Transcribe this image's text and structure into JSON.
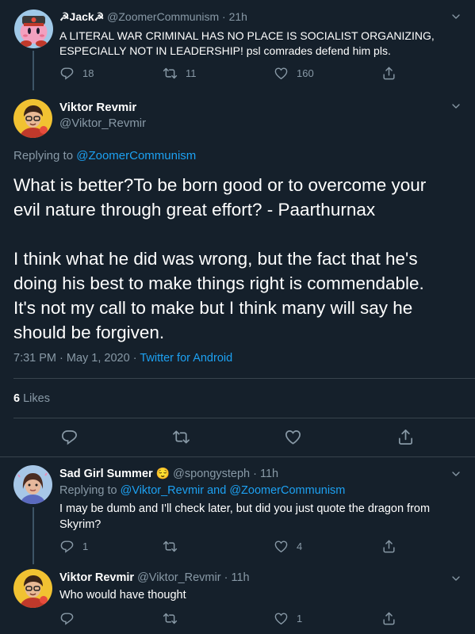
{
  "tweet1": {
    "name": "☭Jack☭",
    "handle": "@ZoomerCommunism",
    "time": "· 21h",
    "text_line1": "A LITERAL WAR CRIMINAL HAS NO PLACE IS SOCIALIST ORGANIZING,",
    "text_line2": "ESPECIALLY NOT IN LEADERSHIP! psl comrades defend him pls.",
    "replies": "18",
    "retweets": "11",
    "likes": "160"
  },
  "main_tweet": {
    "name": "Viktor Revmir",
    "handle": "@Viktor_Revmir",
    "replying_to_label": "Replying to",
    "replying_to_handle": "@ZoomerCommunism",
    "p1_l1": "What is better?To be born good or to overcome your",
    "p1_l2": "evil nature through great effort? - Paarthurnax",
    "p2_l1": "I think what he did was wrong, but the fact that he's",
    "p2_l2": "doing his best to make things right is commendable.",
    "p2_l3": "It's not my call to make but I think many will say he",
    "p2_l4": "should be forgiven.",
    "timestamp": "7:31 PM · May 1, 2020 · ",
    "client": "Twitter for Android",
    "likes_count": "6",
    "likes_label": "Likes"
  },
  "reply1": {
    "name": "Sad Girl Summer",
    "emoji": "😌",
    "handle": "@spongysteph",
    "time": "· 11h",
    "replying_to_label": "Replying to",
    "replying_to_handles": "@Viktor_Revmir and @ZoomerCommunism",
    "text_line1": "I may be dumb and I'll check later, but did you just quote the dragon from",
    "text_line2": "Skyrim?",
    "replies": "1",
    "retweets": "",
    "likes": "4"
  },
  "reply2": {
    "name": "Viktor Revmir",
    "handle": "@Viktor_Revmir",
    "time": "· 11h",
    "text": "Who would have thought",
    "replies": "",
    "retweets": "",
    "likes": "1"
  },
  "colors": {
    "background": "#15202b",
    "accent": "#1da1f2",
    "muted": "#8899a6",
    "divider": "#38444d"
  }
}
